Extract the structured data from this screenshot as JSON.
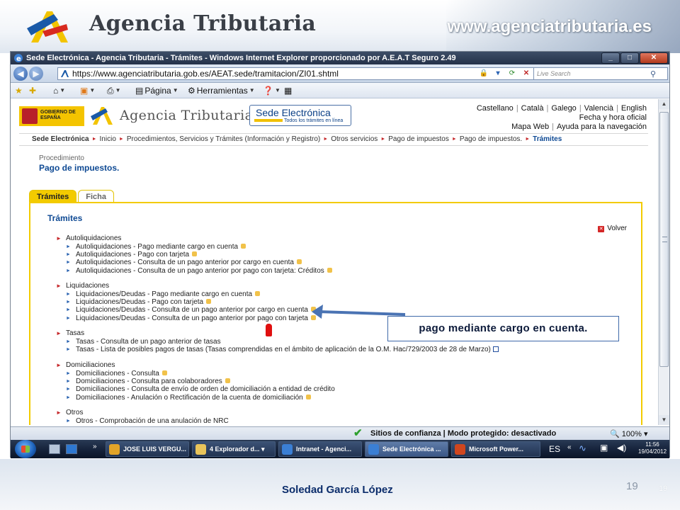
{
  "slide": {
    "title": "Agencia Tributaria",
    "url": "www.agenciatributaria.es",
    "author": "Soledad García López",
    "page_number": "19",
    "page_number_small": "19"
  },
  "browser": {
    "window_title": "Sede Electrónica - Agencia Tributaria - Trámites - Windows Internet Explorer proporcionado por A.E.A.T Seguro 2.49",
    "address": "https://www.agenciatributaria.gob.es/AEAT.sede/tramitacion/ZI01.shtml",
    "search_placeholder": "Live Search",
    "commands": {
      "page": "Página",
      "tools": "Herramientas"
    },
    "status_message": "Sitios de confianza | Modo protegido: desactivado",
    "zoom": "100%"
  },
  "site": {
    "gob_logo_text": "GOBIERNO DE ESPAÑA",
    "title": "Agencia Tributaria",
    "sede_title": "Sede Electrónica",
    "sede_sub": "Todos los trámites en línea",
    "languages": [
      "Castellano",
      "Català",
      "Galego",
      "Valencià",
      "English"
    ],
    "links": [
      "Fecha y hora oficial",
      "Mapa Web",
      "Ayuda para la navegación"
    ]
  },
  "breadcrumb": {
    "root": "Sede Electrónica",
    "items": [
      "Inicio",
      "Procedimientos, Servicios y Trámites (Información y Registro)",
      "Otros servicios",
      "Pago de impuestos",
      "Pago de impuestos."
    ],
    "current": "Trámites"
  },
  "procedure": {
    "label": "Procedimiento",
    "title": "Pago de impuestos."
  },
  "tabs": [
    {
      "label": "Trámites",
      "active": true
    },
    {
      "label": "Ficha",
      "active": false
    }
  ],
  "panel": {
    "title": "Trámites",
    "back": "Volver",
    "sections": [
      {
        "heading": "Autoliquidaciones",
        "items": [
          "Autoliquidaciones - Pago mediante cargo en cuenta",
          "Autoliquidaciones - Pago con tarjeta",
          "Autoliquidaciones - Consulta de un pago anterior por cargo en cuenta",
          "Autoliquidaciones - Consulta de un pago anterior por pago con tarjeta: Créditos"
        ]
      },
      {
        "heading": "Liquidaciones",
        "items": [
          "Liquidaciones/Deudas - Pago mediante cargo en cuenta",
          "Liquidaciones/Deudas - Pago con tarjeta",
          "Liquidaciones/Deudas - Consulta de un pago anterior por cargo en cuenta",
          "Liquidaciones/Deudas - Consulta de un pago anterior por pago con tarjeta"
        ]
      },
      {
        "heading": "Tasas",
        "items": [
          "Tasas - Consulta de un pago anterior de tasas",
          "Tasas - Lista de posibles pagos de tasas (Tasas comprendidas en el ámbito de aplicación de la O.M. Hac/729/2003 de 28 de Marzo)"
        ]
      },
      {
        "heading": "Domiciliaciones",
        "items": [
          "Domiciliaciones - Consulta",
          "Domiciliaciones - Consulta para colaboradores",
          "Domiciliaciones - Consulta de envío de orden de domiciliación a entidad de crédito",
          "Domiciliaciones - Anulación o Rectificación de la cuenta de domiciliación"
        ]
      },
      {
        "heading": "Otros",
        "items": [
          "Otros - Comprobación de una anulación de NRC"
        ]
      }
    ]
  },
  "taskbar": {
    "tasks": [
      "JOSE LUIS VERGU...",
      "4 Explorador d...",
      "Intranet - Agenci...",
      "Sede Electrónica ...",
      "Microsoft Power..."
    ],
    "language": "ES",
    "time": "11:56",
    "date": "19/04/2012"
  },
  "annotation": {
    "callout": "pago mediante cargo en cuenta."
  },
  "colors": {
    "link_blue": "#0f4a94",
    "tab_yellow": "#f3cb00",
    "bullet_red": "#c6282b",
    "author_blue": "#0c2d6b"
  }
}
